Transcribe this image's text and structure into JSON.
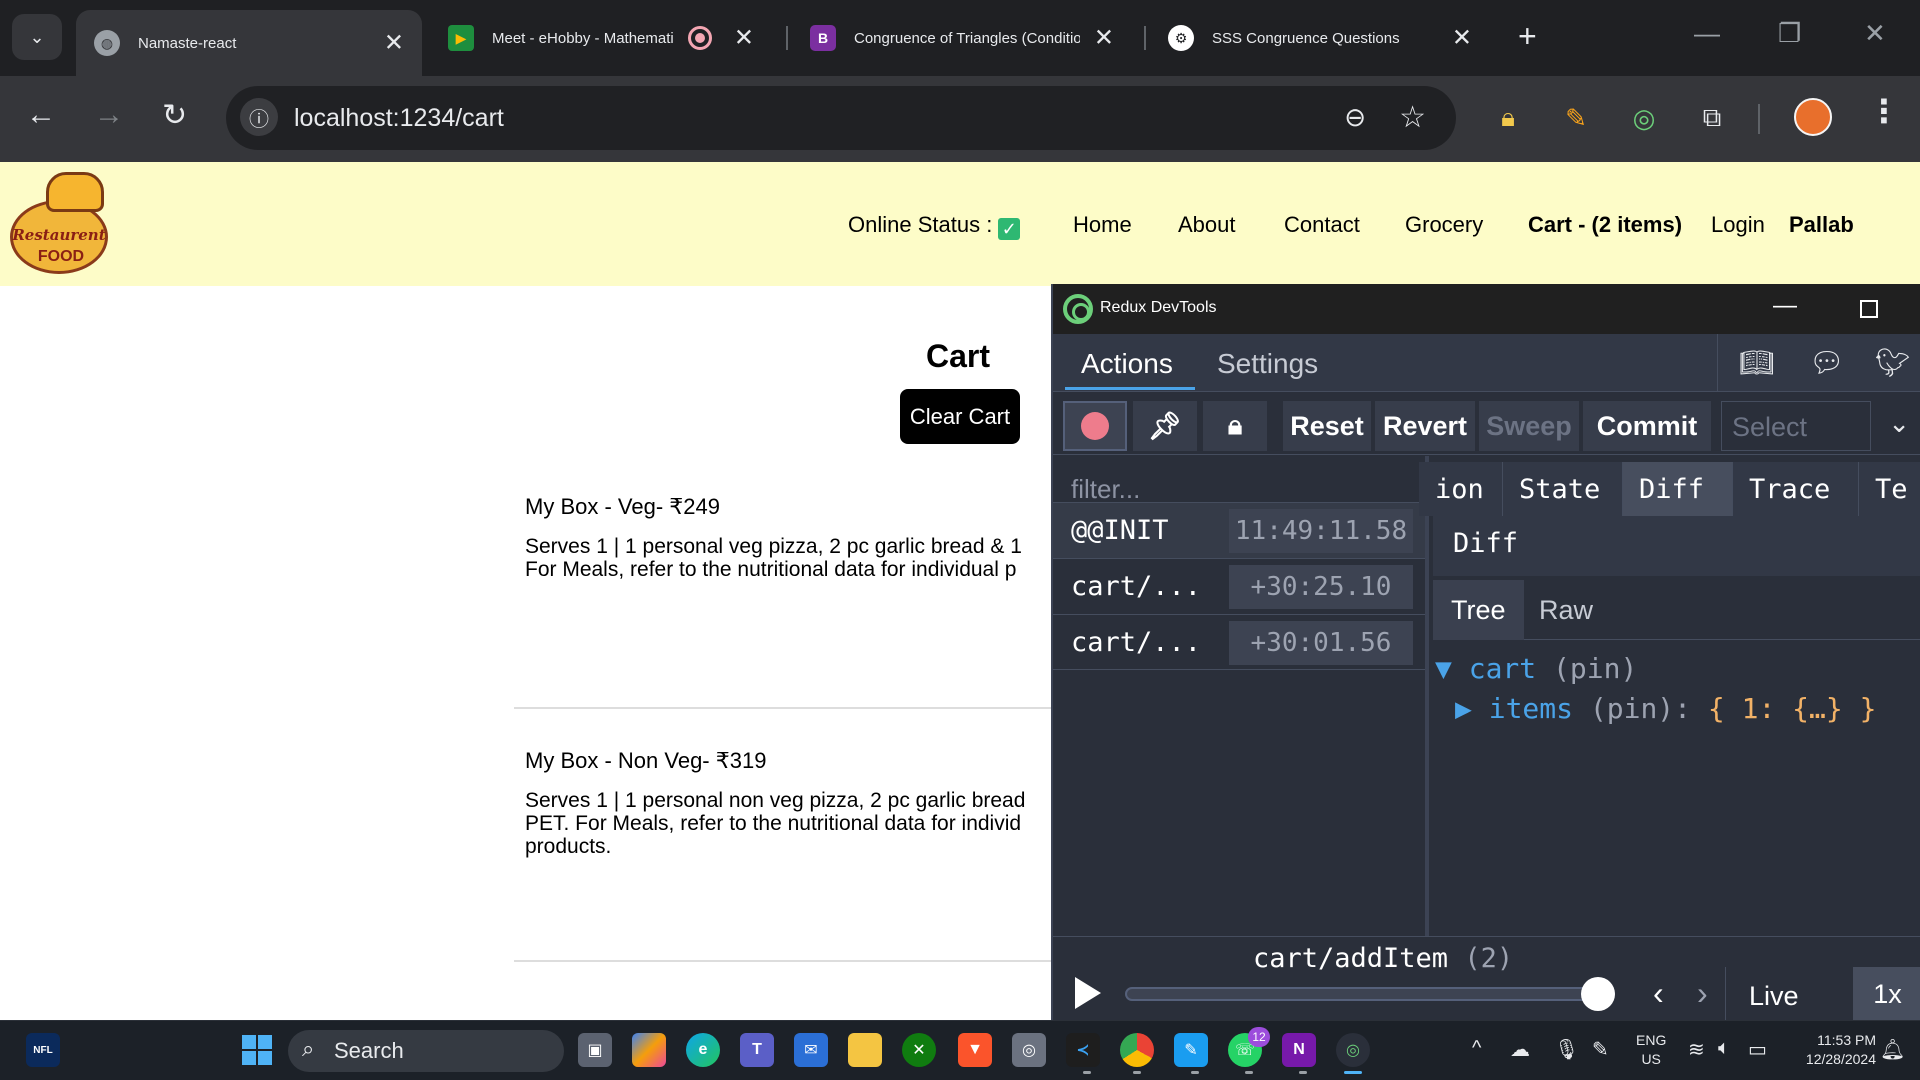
{
  "browser": {
    "tabs": [
      {
        "title": "Namaste-react",
        "active": true,
        "icon": "globe-icon"
      },
      {
        "title": "Meet - eHobby - Mathemati",
        "active": false,
        "icon": "google-meet-icon"
      },
      {
        "title": "Congruence of Triangles (Conditio",
        "active": false,
        "icon": "byjus-icon"
      },
      {
        "title": "SSS Congruence Questions",
        "active": false,
        "icon": "chatgpt-icon"
      }
    ],
    "url": "localhost:1234/cart"
  },
  "site": {
    "logo": {
      "line1": "Restaurent",
      "line2": "FOOD"
    },
    "online_status_label": "Online Status :",
    "online_status_icon": "✓",
    "nav": {
      "home": "Home",
      "about": "About",
      "contact": "Contact",
      "grocery": "Grocery",
      "cart": "Cart - (2 items)",
      "login": "Login",
      "user": "Pallab"
    },
    "cart": {
      "title": "Cart",
      "clear_button": "Clear Cart",
      "items": [
        {
          "name": "My Box - Veg- ₹249",
          "desc_line1": "Serves 1 | 1 personal veg pizza, 2 pc garlic bread & 1",
          "desc_line2": "For Meals, refer to the nutritional data for individual p",
          "desc_line3": ""
        },
        {
          "name": "My Box - Non Veg- ₹319",
          "desc_line1": "Serves 1 | 1 personal non veg pizza, 2 pc garlic bread",
          "desc_line2": "PET. For Meals, refer to the nutritional data for individ",
          "desc_line3": "products."
        }
      ]
    }
  },
  "devtools": {
    "window_title": "Redux DevTools",
    "tabs": {
      "actions": "Actions",
      "settings": "Settings"
    },
    "controls": {
      "reset": "Reset",
      "revert": "Revert",
      "sweep": "Sweep",
      "commit": "Commit",
      "select_placeholder": "Select"
    },
    "filter_placeholder": "filter...",
    "actions": [
      {
        "name": "@@INIT",
        "time": "11:49:11.58"
      },
      {
        "name": "cart/...",
        "time": "+30:25.10"
      },
      {
        "name": "cart/...",
        "time": "+30:01.56"
      }
    ],
    "monitor_tabs": {
      "action": "ion",
      "state": "State",
      "diff": "Diff",
      "trace": "Trace",
      "test": "Te"
    },
    "diff_header": "Diff",
    "view_tabs": {
      "tree": "Tree",
      "raw": "Raw"
    },
    "tree": {
      "root_key": "cart",
      "root_meta": "(pin)",
      "child_key": "items",
      "child_meta": "(pin):",
      "child_value": "{ 1: {…} }"
    },
    "slider": {
      "action_label": "cart/addItem",
      "count": "(2)",
      "progress": 1.0,
      "live": "Live",
      "speed": "1x"
    }
  },
  "taskbar": {
    "search_label": "Search",
    "whatsapp_badge": "12",
    "lang_line1": "ENG",
    "lang_line2": "US",
    "time": "11:53 PM",
    "date": "12/28/2024"
  },
  "colors": {
    "header_bg": "#fdfcc8",
    "devtools_bg": "#2a2f3a",
    "accent_blue": "#4aa3e8",
    "record_pink": "#ee7c8c"
  }
}
